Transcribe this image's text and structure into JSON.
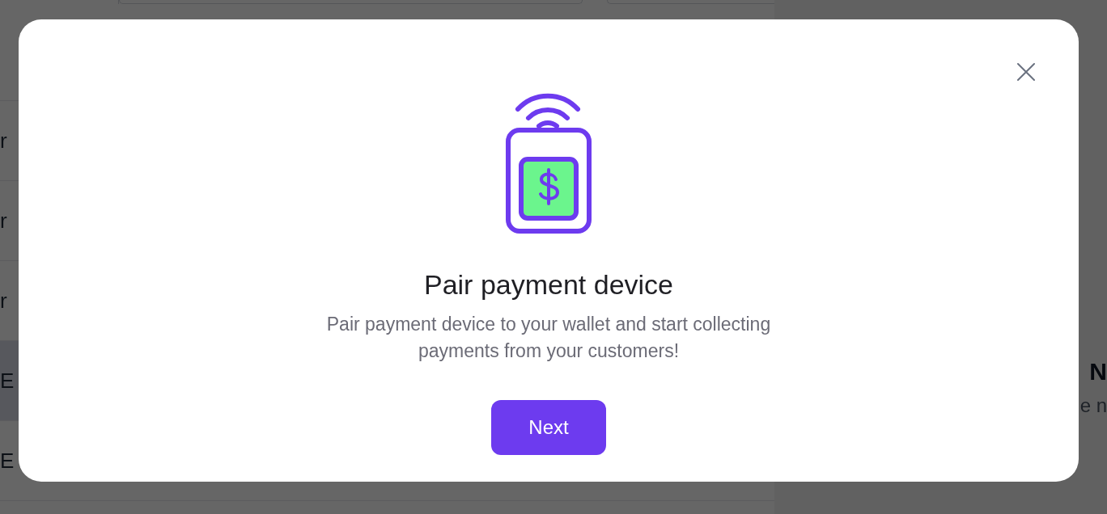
{
  "background": {
    "list_rows": [
      {
        "text": "r",
        "selected": false
      },
      {
        "text": "r",
        "selected": false
      },
      {
        "text": "r",
        "selected": false
      },
      {
        "text": "E",
        "selected": true
      },
      {
        "text": "E",
        "selected": false
      }
    ],
    "side_panel": {
      "title": "N",
      "text": "e n"
    }
  },
  "dialog": {
    "title": "Pair payment device",
    "description": "Pair payment device to your wallet and start collecting payments from your customers!",
    "button": "Next"
  }
}
